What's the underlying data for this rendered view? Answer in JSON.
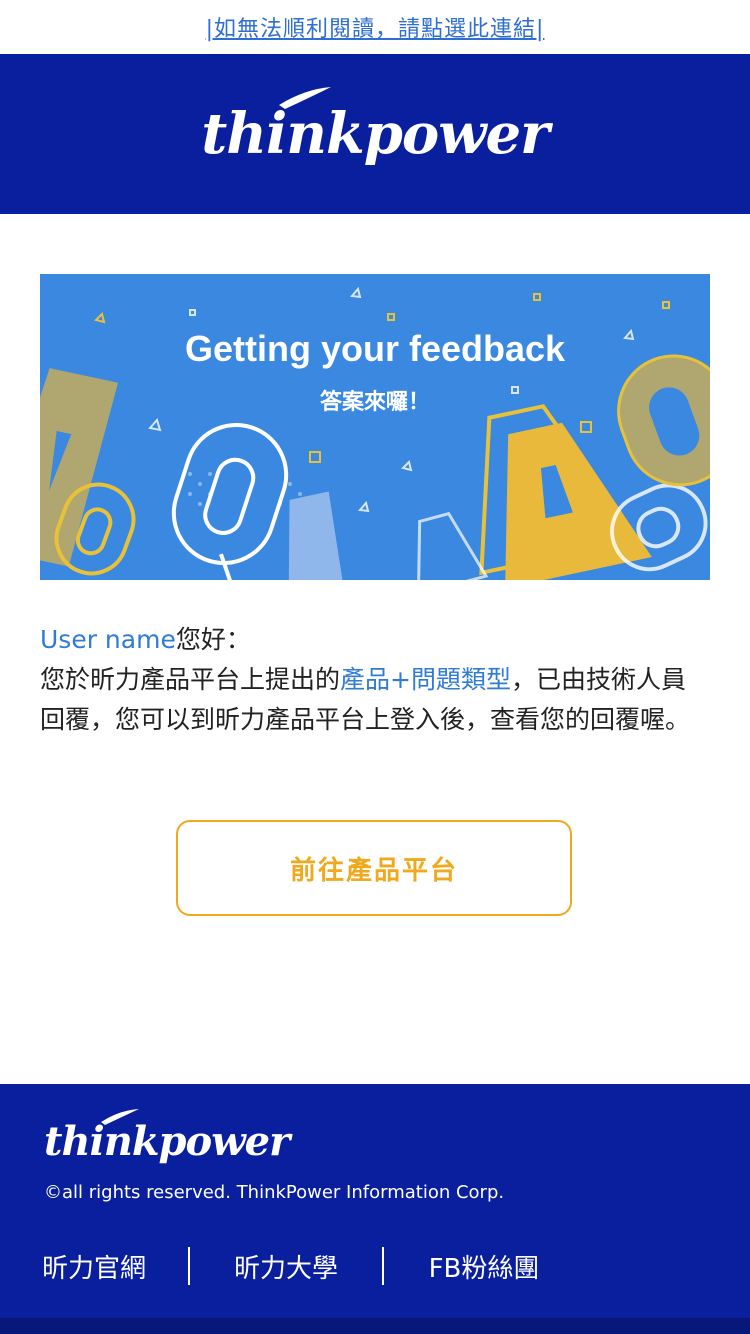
{
  "top_link": {
    "text": "|如無法順利閱讀，請點選此連結|"
  },
  "header": {
    "logo": "thinkpower"
  },
  "banner": {
    "title": "Getting your feedback",
    "subtitle": "答案來囉！"
  },
  "message": {
    "user_name": "User name",
    "greeting": "您好：",
    "line_prefix": "您於昕力產品平台上提出的",
    "highlight": "產品+問題類型",
    "line_suffix": "，已由技術人員回覆，您可以到昕力產品平台上登入後，查看您的回覆喔。"
  },
  "cta": {
    "label": "前往產品平台"
  },
  "footer": {
    "logo": "thinkpower",
    "copyright": "©all rights reserved. ThinkPower Information Corp.",
    "links": [
      "昕力官網",
      "昕力大學",
      "FB粉絲團"
    ]
  },
  "colors": {
    "brand_blue": "#0a1f9e",
    "banner_blue": "#3b88e0",
    "accent_orange": "#f0a81e",
    "link_blue": "#2f7bd6"
  }
}
